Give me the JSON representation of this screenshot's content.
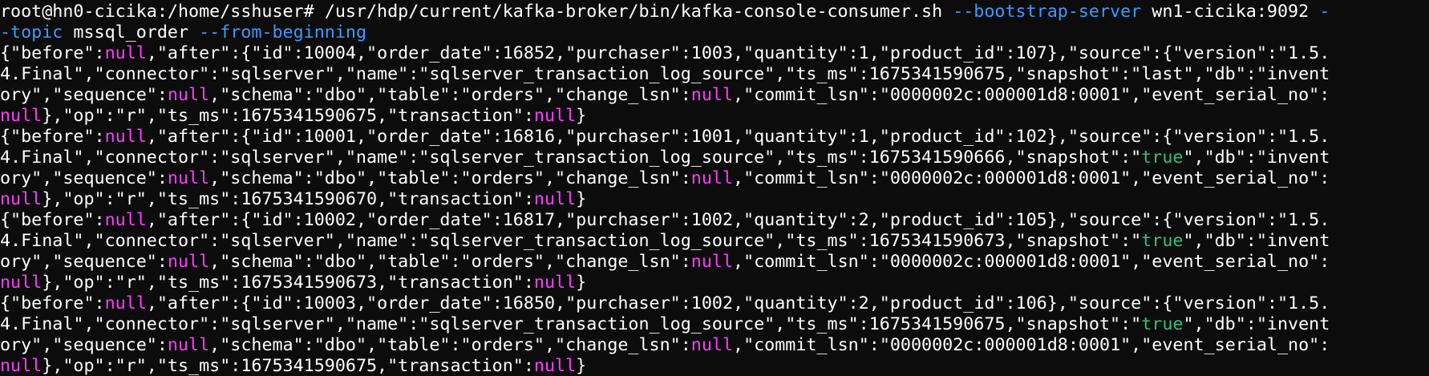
{
  "terminal": {
    "colors": {
      "background": "#0c0c0c",
      "text": "#ffffff",
      "flag": "#3b9bff",
      "null": "#ff3cff",
      "true": "#2ec27e"
    },
    "lines": [
      [
        {
          "t": "root@hn0-cicika:/home/sshuser# /usr/hdp/current/kafka-broker/bin/kafka-console-consumer.sh ",
          "c": "w"
        },
        {
          "t": "--bootstrap-server",
          "c": "flag"
        },
        {
          "t": " wn1-cicika:9092 ",
          "c": "w"
        },
        {
          "t": "-",
          "c": "flag"
        }
      ],
      [
        {
          "t": "-topic",
          "c": "flag"
        },
        {
          "t": " mssql_order ",
          "c": "w"
        },
        {
          "t": "--from-beginning",
          "c": "flag"
        }
      ],
      [
        {
          "t": "{\"before\":",
          "c": "w"
        },
        {
          "t": "null",
          "c": "null"
        },
        {
          "t": ",\"after\":{\"id\":10004,\"order_date\":16852,\"purchaser\":1003,\"quantity\":1,\"product_id\":107},\"source\":{\"version\":\"1.5.",
          "c": "w"
        }
      ],
      [
        {
          "t": "4.Final\",\"connector\":\"sqlserver\",\"name\":\"sqlserver_transaction_log_source\",\"ts_ms\":1675341590675,\"snapshot\":\"last\",\"db\":\"invent",
          "c": "w"
        }
      ],
      [
        {
          "t": "ory\",\"sequence\":",
          "c": "w"
        },
        {
          "t": "null",
          "c": "null"
        },
        {
          "t": ",\"schema\":\"dbo\",\"table\":\"orders\",\"change_lsn\":",
          "c": "w"
        },
        {
          "t": "null",
          "c": "null"
        },
        {
          "t": ",\"commit_lsn\":\"0000002c:000001d8:0001\",\"event_serial_no\":",
          "c": "w"
        }
      ],
      [
        {
          "t": "null",
          "c": "null"
        },
        {
          "t": "},\"op\":\"r\",\"ts_ms\":1675341590675,\"transaction\":",
          "c": "w"
        },
        {
          "t": "null",
          "c": "null"
        },
        {
          "t": "}",
          "c": "w"
        }
      ],
      [
        {
          "t": "{\"before\":",
          "c": "w"
        },
        {
          "t": "null",
          "c": "null"
        },
        {
          "t": ",\"after\":{\"id\":10001,\"order_date\":16816,\"purchaser\":1001,\"quantity\":1,\"product_id\":102},\"source\":{\"version\":\"1.5.",
          "c": "w"
        }
      ],
      [
        {
          "t": "4.Final\",\"connector\":\"sqlserver\",\"name\":\"sqlserver_transaction_log_source\",\"ts_ms\":1675341590666,\"snapshot\":\"",
          "c": "w"
        },
        {
          "t": "true",
          "c": "true"
        },
        {
          "t": "\",\"db\":\"invent",
          "c": "w"
        }
      ],
      [
        {
          "t": "ory\",\"sequence\":",
          "c": "w"
        },
        {
          "t": "null",
          "c": "null"
        },
        {
          "t": ",\"schema\":\"dbo\",\"table\":\"orders\",\"change_lsn\":",
          "c": "w"
        },
        {
          "t": "null",
          "c": "null"
        },
        {
          "t": ",\"commit_lsn\":\"0000002c:000001d8:0001\",\"event_serial_no\":",
          "c": "w"
        }
      ],
      [
        {
          "t": "null",
          "c": "null"
        },
        {
          "t": "},\"op\":\"r\",\"ts_ms\":1675341590670,\"transaction\":",
          "c": "w"
        },
        {
          "t": "null",
          "c": "null"
        },
        {
          "t": "}",
          "c": "w"
        }
      ],
      [
        {
          "t": "{\"before\":",
          "c": "w"
        },
        {
          "t": "null",
          "c": "null"
        },
        {
          "t": ",\"after\":{\"id\":10002,\"order_date\":16817,\"purchaser\":1002,\"quantity\":2,\"product_id\":105},\"source\":{\"version\":\"1.5.",
          "c": "w"
        }
      ],
      [
        {
          "t": "4.Final\",\"connector\":\"sqlserver\",\"name\":\"sqlserver_transaction_log_source\",\"ts_ms\":1675341590673,\"snapshot\":\"",
          "c": "w"
        },
        {
          "t": "true",
          "c": "true"
        },
        {
          "t": "\",\"db\":\"invent",
          "c": "w"
        }
      ],
      [
        {
          "t": "ory\",\"sequence\":",
          "c": "w"
        },
        {
          "t": "null",
          "c": "null"
        },
        {
          "t": ",\"schema\":\"dbo\",\"table\":\"orders\",\"change_lsn\":",
          "c": "w"
        },
        {
          "t": "null",
          "c": "null"
        },
        {
          "t": ",\"commit_lsn\":\"0000002c:000001d8:0001\",\"event_serial_no\":",
          "c": "w"
        }
      ],
      [
        {
          "t": "null",
          "c": "null"
        },
        {
          "t": "},\"op\":\"r\",\"ts_ms\":1675341590673,\"transaction\":",
          "c": "w"
        },
        {
          "t": "null",
          "c": "null"
        },
        {
          "t": "}",
          "c": "w"
        }
      ],
      [
        {
          "t": "{\"before\":",
          "c": "w"
        },
        {
          "t": "null",
          "c": "null"
        },
        {
          "t": ",\"after\":{\"id\":10003,\"order_date\":16850,\"purchaser\":1002,\"quantity\":2,\"product_id\":106},\"source\":{\"version\":\"1.5.",
          "c": "w"
        }
      ],
      [
        {
          "t": "4.Final\",\"connector\":\"sqlserver\",\"name\":\"sqlserver_transaction_log_source\",\"ts_ms\":1675341590675,\"snapshot\":\"",
          "c": "w"
        },
        {
          "t": "true",
          "c": "true"
        },
        {
          "t": "\",\"db\":\"invent",
          "c": "w"
        }
      ],
      [
        {
          "t": "ory\",\"sequence\":",
          "c": "w"
        },
        {
          "t": "null",
          "c": "null"
        },
        {
          "t": ",\"schema\":\"dbo\",\"table\":\"orders\",\"change_lsn\":",
          "c": "w"
        },
        {
          "t": "null",
          "c": "null"
        },
        {
          "t": ",\"commit_lsn\":\"0000002c:000001d8:0001\",\"event_serial_no\":",
          "c": "w"
        }
      ],
      [
        {
          "t": "null",
          "c": "null"
        },
        {
          "t": "},\"op\":\"r\",\"ts_ms\":1675341590675,\"transaction\":",
          "c": "w"
        },
        {
          "t": "null",
          "c": "null"
        },
        {
          "t": "}",
          "c": "w"
        }
      ]
    ]
  }
}
